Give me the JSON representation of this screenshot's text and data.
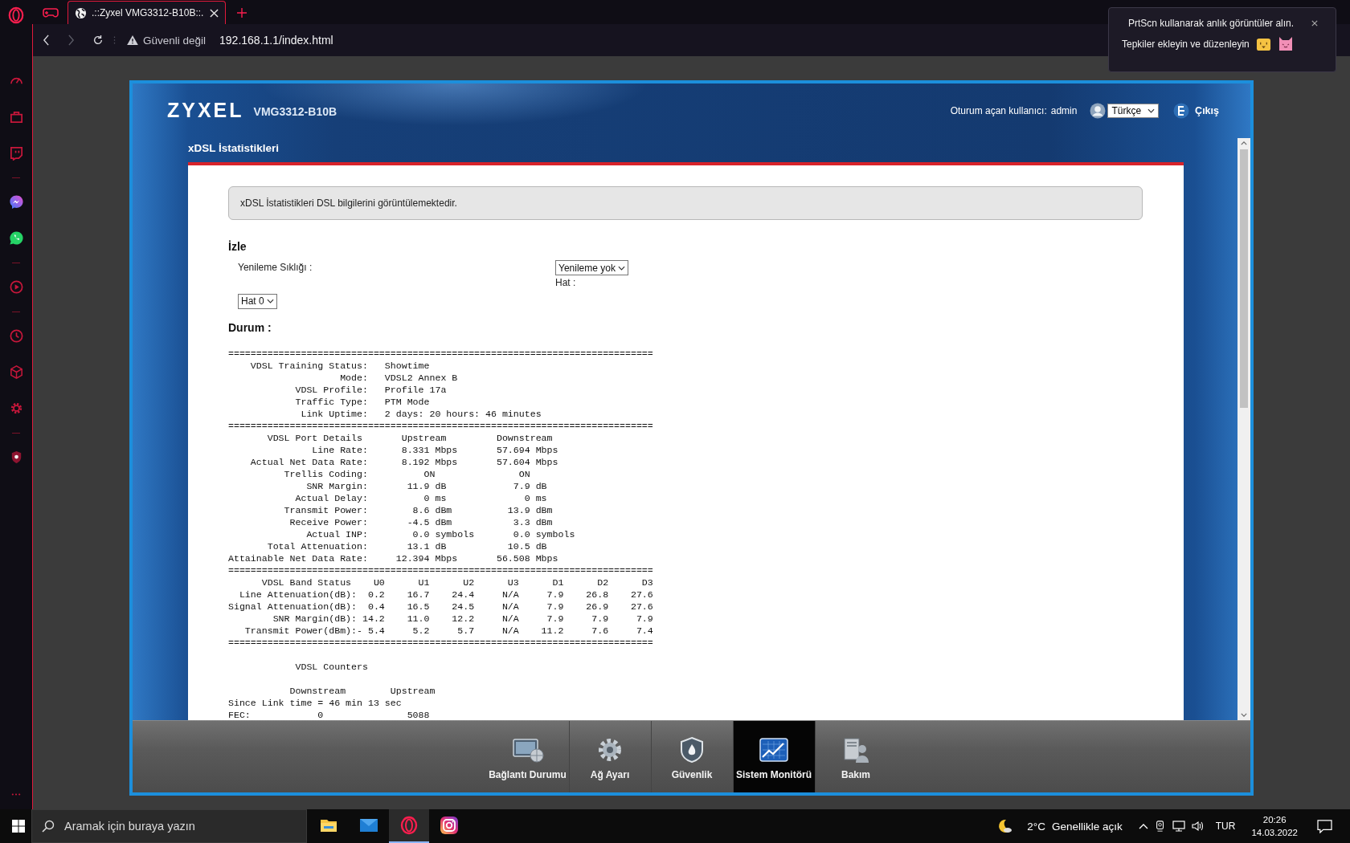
{
  "browser": {
    "tabs": [
      {
        "kind": "icon",
        "selected": false
      },
      {
        "kind": "page",
        "title": ".::Zyxel VMG3312-B10B::.",
        "selected": true
      }
    ],
    "security_label": "Güvenli değil",
    "url": "192.168.1.1/index.html"
  },
  "notification": {
    "line1": "PrtScn kullanarak anlık görüntüler alın.",
    "line2": "Tepkiler ekleyin ve düzenleyin"
  },
  "router": {
    "brand": "ZYXEL",
    "model": "VMG3312-B10B",
    "user_label": "Oturum açan kullanıcı:",
    "user": "admin",
    "language": "Türkçe",
    "logout": "Çıkış",
    "page_title": "xDSL İstatistikleri",
    "info": "xDSL İstatistikleri DSL bilgilerini görüntülemektedir.",
    "monitor_heading": "İzle",
    "refresh_label": "Yenileme Sıklığı :",
    "refresh_value": "Yenileme yok",
    "line_label": "Hat :",
    "line_value": "Hat 0",
    "status_heading": "Durum :",
    "report_blocks": [
      {
        "lines": [
          "============================================================================",
          "    VDSL Training Status:   Showtime",
          "                    Mode:   VDSL2 Annex B",
          "            VDSL Profile:   Profile 17a",
          "            Traffic Type:   PTM Mode",
          "             Link Uptime:   2 days: 20 hours: 46 minutes",
          "============================================================================",
          "       VDSL Port Details       Upstream         Downstream",
          "               Line Rate:      8.331 Mbps       57.694 Mbps",
          "    Actual Net Data Rate:      8.192 Mbps       57.604 Mbps",
          "          Trellis Coding:          ON               ON",
          "              SNR Margin:       11.9 dB            7.9 dB",
          "            Actual Delay:          0 ms              0 ms",
          "          Transmit Power:        8.6 dBm          13.9 dBm",
          "           Receive Power:       -4.5 dBm           3.3 dBm",
          "              Actual INP:        0.0 symbols       0.0 symbols",
          "       Total Attenuation:       13.1 dB           10.5 dB",
          "Attainable Net Data Rate:     12.394 Mbps       56.508 Mbps",
          "============================================================================",
          "      VDSL Band Status    U0      U1      U2      U3      D1      D2      D3",
          "  Line Attenuation(dB):  0.2    16.7    24.4     N/A     7.9    26.8    27.6",
          "Signal Attenuation(dB):  0.4    16.5    24.5     N/A     7.9    26.9    27.6",
          "        SNR Margin(dB): 14.2    11.0    12.2     N/A     7.9     7.9     7.9",
          "   Transmit Power(dBm):- 5.4     5.2     5.7     N/A    11.2     7.6     7.4",
          "============================================================================"
        ]
      },
      {
        "lines": [
          "            VDSL Counters"
        ]
      },
      {
        "lines": [
          "           Downstream        Upstream",
          "Since Link time = 46 min 13 sec",
          "FEC:            0               5088"
        ]
      }
    ]
  },
  "nav": [
    {
      "kind": "connection",
      "label": "Bağlantı Durumu",
      "selected": false
    },
    {
      "kind": "network",
      "label": "Ağ Ayarı",
      "selected": false
    },
    {
      "kind": "security",
      "label": "Güvenlik",
      "selected": false
    },
    {
      "kind": "monitor",
      "label": "Sistem Monitörü",
      "selected": true
    },
    {
      "kind": "maintenance",
      "label": "Bakım",
      "selected": false
    }
  ],
  "taskbar": {
    "search_placeholder": "Aramak için buraya yazın",
    "apps": [
      {
        "kind": "explorer",
        "selected": false
      },
      {
        "kind": "mail",
        "selected": false
      },
      {
        "kind": "opera",
        "selected": true
      },
      {
        "kind": "instagram",
        "selected": false
      }
    ],
    "temperature": "2°C",
    "weather": "Genellikle açık",
    "language": "TUR",
    "time": "20:26",
    "date": "14.03.2022"
  }
}
